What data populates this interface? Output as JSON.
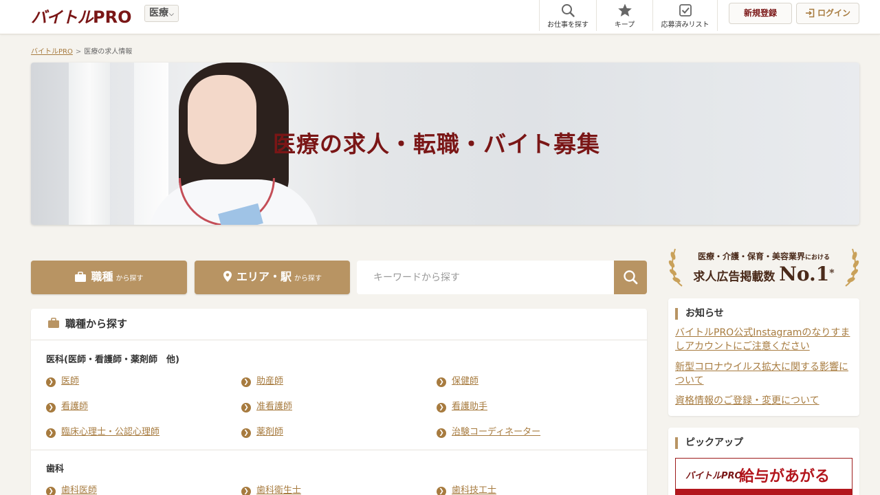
{
  "header": {
    "logo_main": "バイトル",
    "logo_pro": "PRO",
    "category_select": "医療",
    "nav": {
      "search": "お仕事を探す",
      "keep": "キープ",
      "applied": "応募済みリスト"
    },
    "register_button": "新規登録",
    "login_button": "ログイン"
  },
  "breadcrumb": {
    "home": "バイトルPRO",
    "separator": ">",
    "current": "医療の求人情報"
  },
  "hero": {
    "title": "医療の求人・転職・バイト募集"
  },
  "search": {
    "job_tab_main": "職種",
    "job_tab_sub": "から探す",
    "area_tab_main": "エリア・駅",
    "area_tab_sub": "から探す",
    "keyword_placeholder": "キーワードから探す"
  },
  "job_panel": {
    "title": "職種から探す",
    "groups": [
      {
        "title": "医科(医師・看護師・薬剤師　他)",
        "items": [
          "医師",
          "助産師",
          "保健師",
          "看護師",
          "准看護師",
          "看護助手",
          "臨床心理士・公認心理師",
          "薬剤師",
          "治験コーディネーター"
        ]
      },
      {
        "title": "歯科",
        "items": [
          "歯科医師",
          "歯科衛生士",
          "歯科技工士"
        ]
      }
    ]
  },
  "award": {
    "line1_main": "医療・介護・保育・美容業界",
    "line1_small": "における",
    "line2_main": "求人広告掲載数",
    "line2_no1": "No.1",
    "line2_mark": "*"
  },
  "news": {
    "title": "お知らせ",
    "items": [
      "バイトルPRO公式Instagramのなりすましアカウントにご注意ください",
      "新型コロナウイルス拡大に関する影響について",
      "資格情報のご登録・変更について"
    ]
  },
  "pickup": {
    "title": "ピックアップ",
    "banner_logo": "バイトルPRO",
    "banner_text": "給与があがる"
  },
  "colors": {
    "brand": "#7a1616",
    "accent": "#b89463",
    "link": "#a77b3f",
    "background": "#f5f3ee"
  },
  "icons": {
    "search": "magnifier-icon",
    "keep": "star-icon",
    "applied": "checkbox-icon",
    "login": "login-icon",
    "job": "briefcase-icon",
    "area": "map-pin-icon",
    "arrow": "chevron-right-circle-icon"
  }
}
